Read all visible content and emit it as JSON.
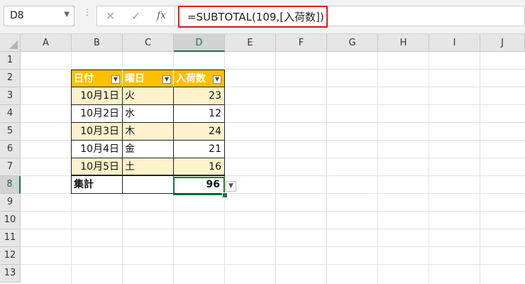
{
  "name_box": "D8",
  "formula": "=SUBTOTAL(109,[入荷数])",
  "columns": [
    "A",
    "B",
    "C",
    "D",
    "E",
    "F",
    "G",
    "H",
    "I",
    "J"
  ],
  "rows": [
    "1",
    "2",
    "3",
    "4",
    "5",
    "6",
    "7",
    "8",
    "9",
    "10",
    "11",
    "12",
    "13"
  ],
  "table": {
    "headers": [
      "日付",
      "曜日",
      "入荷数"
    ],
    "rows": [
      {
        "date": "10月1日",
        "day": "火",
        "qty": "23"
      },
      {
        "date": "10月2日",
        "day": "水",
        "qty": "12"
      },
      {
        "date": "10月3日",
        "day": "木",
        "qty": "24"
      },
      {
        "date": "10月4日",
        "day": "金",
        "qty": "21"
      },
      {
        "date": "10月5日",
        "day": "土",
        "qty": "16"
      }
    ],
    "total_label": "集計",
    "total_value": "96"
  },
  "colors": {
    "header": "#ffc000",
    "band": "#fff2cc",
    "selection": "#217346",
    "formula_highlight": "#e02020"
  }
}
